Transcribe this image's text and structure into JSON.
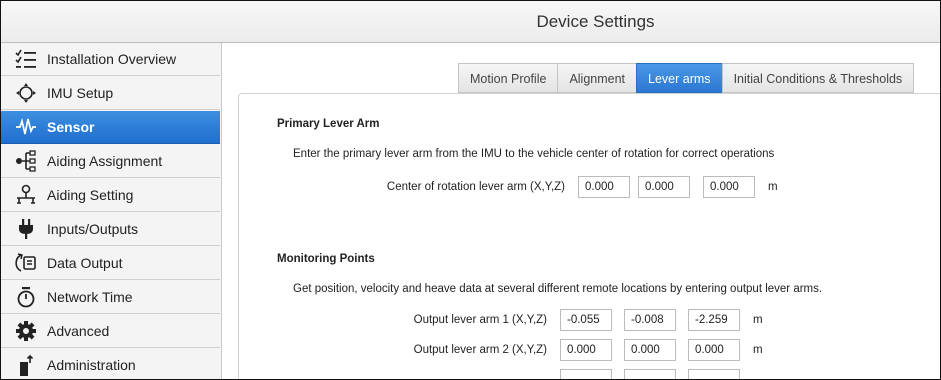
{
  "window": {
    "title": "Device Settings"
  },
  "sidebar": {
    "items": [
      {
        "label": "Installation Overview",
        "icon": "checklist-icon",
        "active": false
      },
      {
        "label": "IMU Setup",
        "icon": "imu-icon",
        "active": false
      },
      {
        "label": "Sensor",
        "icon": "waveform-icon",
        "active": true
      },
      {
        "label": "Aiding Assignment",
        "icon": "assignment-icon",
        "active": false
      },
      {
        "label": "Aiding Setting",
        "icon": "aiding-setting-icon",
        "active": false
      },
      {
        "label": "Inputs/Outputs",
        "icon": "plug-icon",
        "active": false
      },
      {
        "label": "Data Output",
        "icon": "data-output-icon",
        "active": false
      },
      {
        "label": "Network Time",
        "icon": "stopwatch-icon",
        "active": false
      },
      {
        "label": "Advanced",
        "icon": "gear-icon",
        "active": false
      },
      {
        "label": "Administration",
        "icon": "administration-icon",
        "active": false
      }
    ]
  },
  "tabs": [
    {
      "label": "Motion Profile",
      "active": false
    },
    {
      "label": "Alignment",
      "active": false
    },
    {
      "label": "Lever arms",
      "active": true
    },
    {
      "label": "Initial Conditions & Thresholds",
      "active": false
    }
  ],
  "primary": {
    "title": "Primary Lever Arm",
    "description": "Enter the primary lever arm from the IMU to the vehicle center of rotation for correct operations",
    "row": {
      "label": "Center of rotation lever arm (X,Y,Z)",
      "x": "0.000",
      "y": "0.000",
      "z": "0.000",
      "unit": "m"
    }
  },
  "monitoring": {
    "title": "Monitoring Points",
    "description": "Get position, velocity and heave data at several different remote locations by entering output lever arms.",
    "rows": [
      {
        "label": "Output lever arm 1 (X,Y,Z)",
        "x": "-0.055",
        "y": "-0.008",
        "z": "-2.259",
        "unit": "m"
      },
      {
        "label": "Output lever arm 2 (X,Y,Z)",
        "x": "0.000",
        "y": "0.000",
        "z": "0.000",
        "unit": "m"
      }
    ]
  },
  "colors": {
    "accent": "#2a78d2",
    "sidebar_bg": "#f4f4f4"
  }
}
